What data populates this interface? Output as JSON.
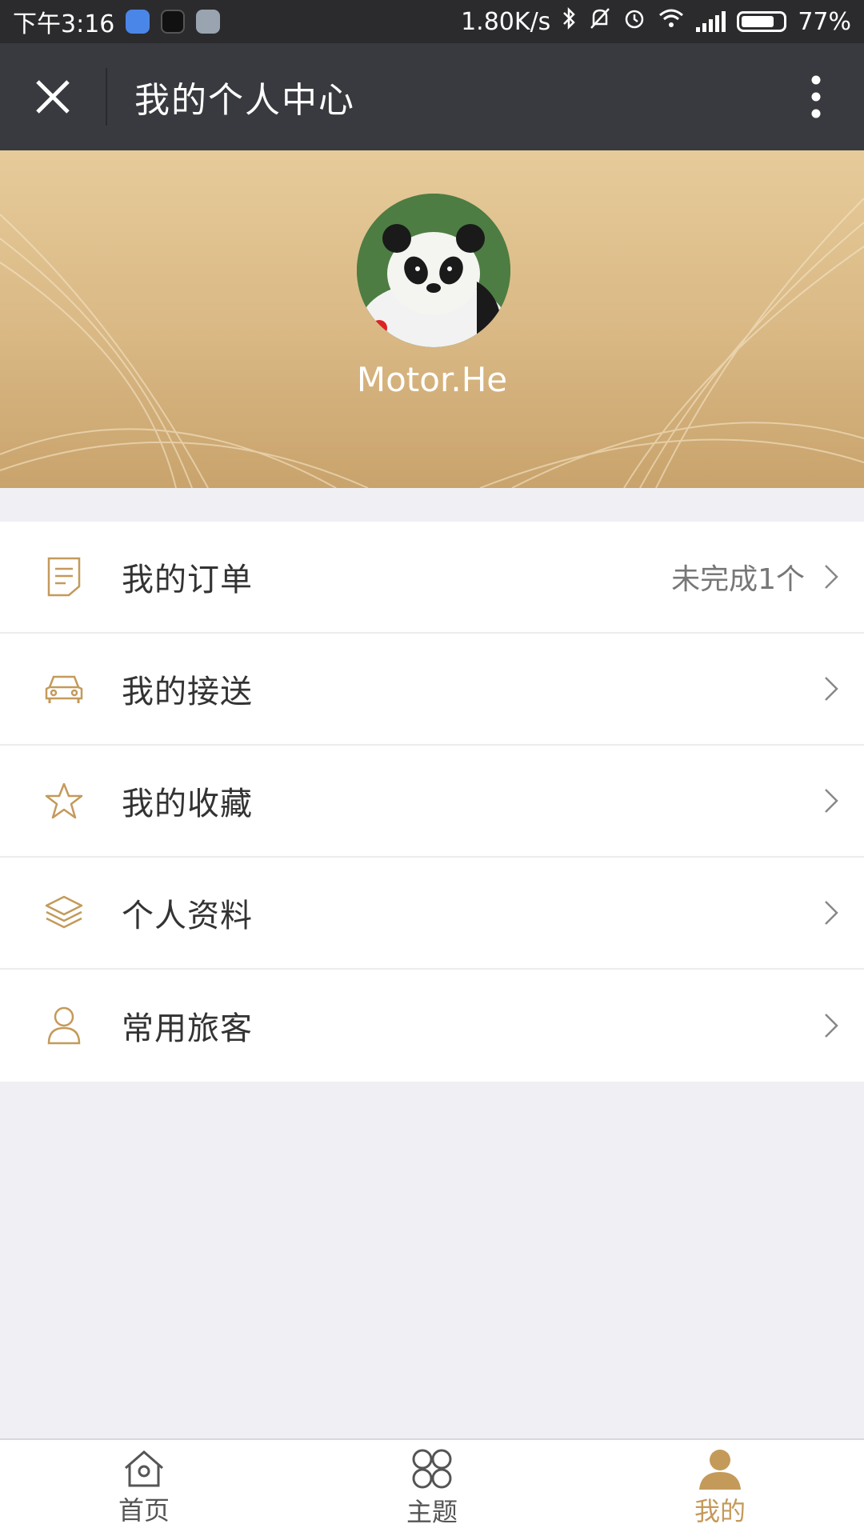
{
  "status_bar": {
    "time": "下午3:16",
    "net_speed": "1.80K/s",
    "battery": "77%",
    "icons": [
      "cloud-app-icon",
      "tiktok-app-icon",
      "misc-app-icon",
      "bluetooth-icon",
      "mute-icon",
      "alarm-icon",
      "wifi-icon",
      "signal-icon",
      "battery-icon"
    ]
  },
  "titlebar": {
    "title": "我的个人中心",
    "close_icon": "close-icon",
    "more_icon": "more-icon"
  },
  "profile": {
    "username": "Motor.He",
    "avatar_icon": "panda-avatar"
  },
  "menu": {
    "items": [
      {
        "label": "我的订单",
        "extra": "未完成1个",
        "icon": "order-document-icon"
      },
      {
        "label": "我的接送",
        "extra": "",
        "icon": "car-icon"
      },
      {
        "label": "我的收藏",
        "extra": "",
        "icon": "star-icon"
      },
      {
        "label": "个人资料",
        "extra": "",
        "icon": "layers-icon"
      },
      {
        "label": "常用旅客",
        "extra": "",
        "icon": "person-icon"
      }
    ]
  },
  "bottom_nav": {
    "items": [
      {
        "label": "首页",
        "icon": "home-icon"
      },
      {
        "label": "主题",
        "icon": "theme-grid-icon"
      },
      {
        "label": "我的",
        "icon": "user-icon",
        "active": true
      }
    ]
  },
  "colors": {
    "accent_gold": "#c49a5a",
    "titlebar_bg": "#393a3f",
    "statusbar_bg": "#2b2b2d"
  }
}
